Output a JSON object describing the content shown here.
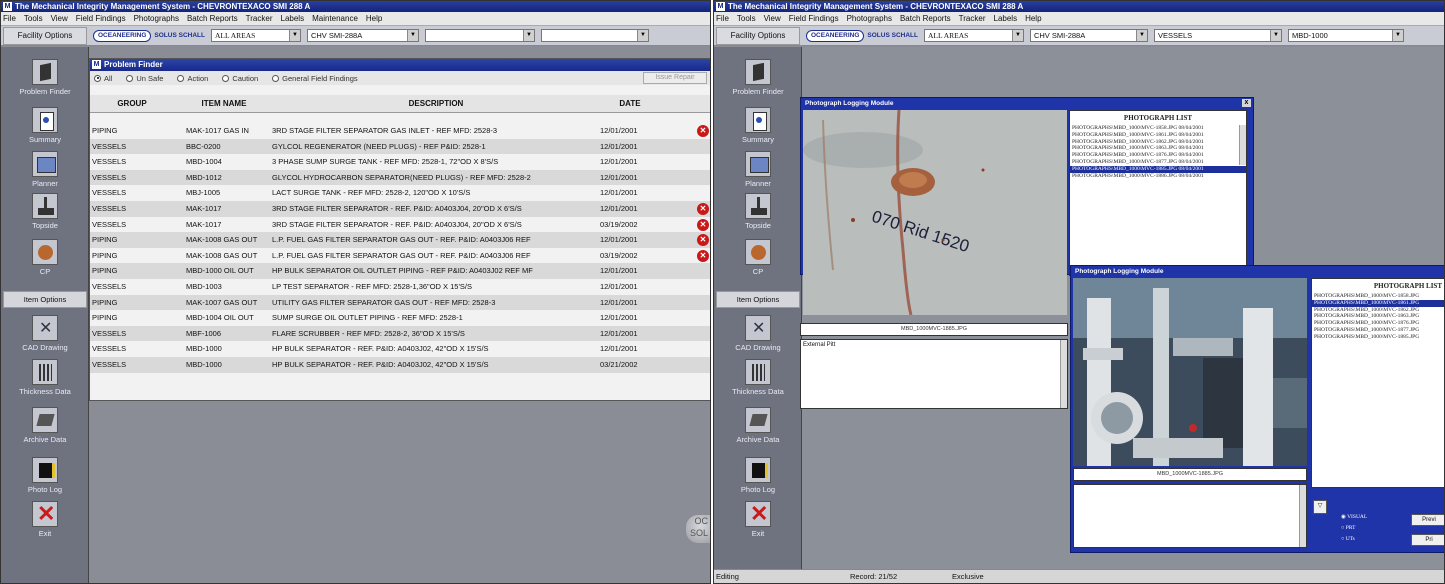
{
  "left": {
    "title": "The Mechanical Integrity Management System - CHEVRONTEXACO SMI 288 A",
    "menu": [
      "File",
      "Tools",
      "View",
      "Field Findings",
      "Photographs",
      "Batch Reports",
      "Tracker",
      "Labels",
      "Maintenance",
      "Help"
    ],
    "facility_options": "Facility Options",
    "logo": "OCEANEERING",
    "logo_sub": "SOLUS SCHALL",
    "combos": [
      "ALL AREAS",
      "CHV SMI-288A",
      "",
      ""
    ],
    "sidebar": {
      "problem_finder": "Problem Finder",
      "summary": "Summary",
      "planner": "Planner",
      "topside": "Topside",
      "cp": "CP",
      "item_options": "Item Options",
      "cad_drawing": "CAD Drawing",
      "thickness_data": "Thickness Data",
      "archive_data": "Archive Data",
      "photo_log": "Photo Log",
      "exit": "Exit"
    },
    "problem_finder": {
      "title": "Problem Finder",
      "filters": [
        "All",
        "Un Safe",
        "Action",
        "Caution",
        "General Field Findings"
      ],
      "issue_button": "Issue Repair",
      "columns": [
        "GROUP",
        "ITEM NAME",
        "DESCRIPTION",
        "DATE"
      ],
      "rows": [
        {
          "group": "PIPING",
          "item": "MAK-1017 GAS IN",
          "desc": "3RD STAGE FILTER SEPARATOR GAS INLET - REF MFD: 2528-3",
          "date": "12/01/2001",
          "flag": true
        },
        {
          "group": "VESSELS",
          "item": "BBC-0200",
          "desc": "GYLCOL REGENERATOR (NEED PLUGS) - REF P&ID: 2528-1",
          "date": "12/01/2001",
          "flag": false
        },
        {
          "group": "VESSELS",
          "item": "MBD-1004",
          "desc": "3 PHASE SUMP SURGE TANK - REF MFD: 2528-1, 72\"OD X 8'S/S",
          "date": "12/01/2001",
          "flag": false
        },
        {
          "group": "VESSELS",
          "item": "MBD-1012",
          "desc": "GLYCOL HYDROCARBON SEPARATOR(NEED PLUGS) - REF MFD: 2528-2",
          "date": "12/01/2001",
          "flag": false
        },
        {
          "group": "VESSELS",
          "item": "MBJ-1005",
          "desc": "LACT SURGE TANK - REF MFD: 2528-2, 120\"OD X 10'S/S",
          "date": "12/01/2001",
          "flag": false
        },
        {
          "group": "VESSELS",
          "item": "MAK-1017",
          "desc": "3RD STAGE FILTER SEPARATOR - REF. P&ID: A0403J04, 20\"OD X 6'S/S",
          "date": "12/01/2001",
          "flag": true
        },
        {
          "group": "VESSELS",
          "item": "MAK-1017",
          "desc": "3RD STAGE FILTER SEPARATOR - REF. P&ID: A0403J04, 20\"OD X 6'S/S",
          "date": "03/19/2002",
          "flag": true
        },
        {
          "group": "PIPING",
          "item": "MAK-1008 GAS OUT",
          "desc": "L.P. FUEL GAS FILTER SEPARATOR GAS OUT - REF. P&ID: A0403J06 REF",
          "date": "12/01/2001",
          "flag": true
        },
        {
          "group": "PIPING",
          "item": "MAK-1008 GAS OUT",
          "desc": "L.P. FUEL GAS FILTER SEPARATOR GAS OUT - REF. P&ID: A0403J06 REF",
          "date": "03/19/2002",
          "flag": true
        },
        {
          "group": "PIPING",
          "item": "MBD-1000 OIL OUT",
          "desc": "HP BULK SEPARATOR OIL OUTLET PIPING - REF P&ID: A0403J02 REF MF",
          "date": "12/01/2001",
          "flag": false
        },
        {
          "group": "VESSELS",
          "item": "MBD-1003",
          "desc": "LP TEST SEPARATOR - REF MFD: 2528-1,36\"OD X 15'S/S",
          "date": "12/01/2001",
          "flag": false
        },
        {
          "group": "PIPING",
          "item": "MAK-1007 GAS OUT",
          "desc": "UTILITY GAS FILTER SEPARATOR GAS OUT - REF MFD: 2528-3",
          "date": "12/01/2001",
          "flag": false
        },
        {
          "group": "PIPING",
          "item": "MBD-1004 OIL OUT",
          "desc": "SUMP SURGE OIL OUTLET PIPING - REF MFD: 2528-1",
          "date": "12/01/2001",
          "flag": false
        },
        {
          "group": "VESSELS",
          "item": "MBF-1006",
          "desc": "FLARE SCRUBBER - REF MFD: 2528-2, 36\"OD X 15'S/S",
          "date": "12/01/2001",
          "flag": false
        },
        {
          "group": "VESSELS",
          "item": "MBD-1000",
          "desc": "HP BULK SEPARATOR - REF. P&ID: A0403J02, 42\"OD X 15'S/S",
          "date": "12/01/2001",
          "flag": false
        },
        {
          "group": "VESSELS",
          "item": "MBD-1000",
          "desc": "HP BULK SEPARATOR - REF. P&ID: A0403J02, 42\"OD X 15'S/S",
          "date": "03/21/2002",
          "flag": false
        }
      ]
    },
    "corner_logo": "OC SOL"
  },
  "right": {
    "title": "The Mechanical Integrity Management System - CHEVRONTEXACO SMI 288 A",
    "menu": [
      "File",
      "Tools",
      "View",
      "Field Findings",
      "Photographs",
      "Batch Reports",
      "Tracker",
      "Labels",
      "Help"
    ],
    "facility_options": "Facility Options",
    "logo": "OCEANEERING",
    "logo_sub": "SOLUS SCHALL",
    "combos": [
      "ALL AREAS",
      "CHV SMI-288A",
      "VESSELS",
      "MBD-1000"
    ],
    "sidebar": {
      "problem_finder": "Problem Finder",
      "summary": "Summary",
      "planner": "Planner",
      "topside": "Topside",
      "cp": "CP",
      "item_options": "Item Options",
      "cad_drawing": "CAD Drawing",
      "thickness_data": "Thickness Data",
      "archive_data": "Archive Data",
      "photo_log": "Photo Log",
      "exit": "Exit"
    },
    "plm1": {
      "title": "Photograph Logging Module",
      "close": "x",
      "photo_text": "070 Rid 1520",
      "caption": "MBD_1000MVC-1885.JPG",
      "notes": "External Pitt",
      "list_title": "PHOTOGRAPH LIST",
      "items": [
        "PHOTOGRAPHS\\MBD_1000\\MVC-1858.JPG   08/04/2001",
        "PHOTOGRAPHS\\MBD_1000\\MVC-1861.JPG   08/04/2001",
        "PHOTOGRAPHS\\MBD_1000\\MVC-1862.JPG   08/04/2001",
        "PHOTOGRAPHS\\MBD_1000\\MVC-1863.JPG   08/04/2001",
        "PHOTOGRAPHS\\MBD_1000\\MVC-1876.JPG   08/04/2001",
        "PHOTOGRAPHS\\MBD_1000\\MVC-1877.JPG   08/04/2001",
        "PHOTOGRAPHS\\MBD_1000\\MVC-1885.JPG   08/04/2001",
        "PHOTOGRAPHS\\MBD_1000\\MVC-1886.JPG   08/04/2001"
      ],
      "selected_index": 6
    },
    "plm2": {
      "title": "Photograph Logging Module",
      "caption": "MBD_1000MVC-1885.JPG",
      "list_title": "PHOTOGRAPH LIST",
      "items": [
        "PHOTOGRAPHS\\MBD_1000\\MVC-1858.JPG",
        "PHOTOGRAPHS\\MBD_1000\\MVC-1861.JPG",
        "PHOTOGRAPHS\\MBD_1000\\MVC-1862.JPG",
        "PHOTOGRAPHS\\MBD_1000\\MVC-1863.JPG",
        "PHOTOGRAPHS\\MBD_1000\\MVC-1876.JPG",
        "PHOTOGRAPHS\\MBD_1000\\MVC-1877.JPG",
        "PHOTOGRAPHS\\MBD_1000\\MVC-1885.JPG"
      ],
      "selected_index": 1,
      "radios": [
        "VISUAL",
        "PRT",
        "UTs"
      ],
      "btn1": "Previ",
      "btn2": "Pri"
    },
    "status": {
      "left": "Editing",
      "record": "Record: 21/52",
      "mode": "Exclusive"
    }
  }
}
